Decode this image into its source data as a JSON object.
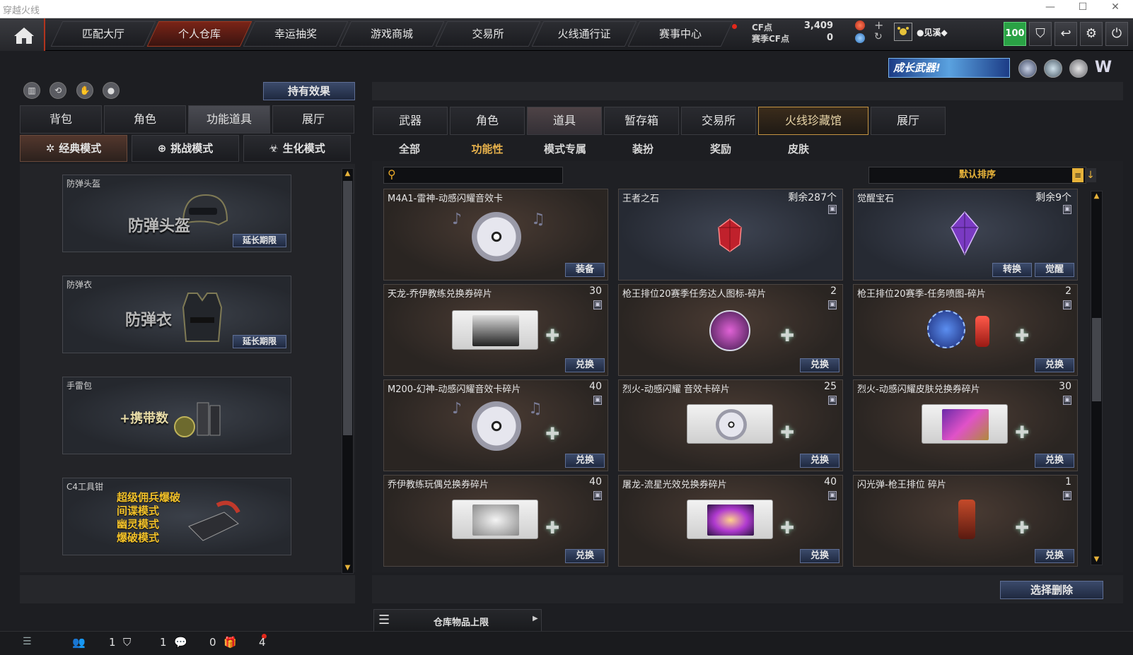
{
  "window": {
    "title": "穿越火线"
  },
  "nav": {
    "tabs": [
      "匹配大厅",
      "个人仓库",
      "幸运抽奖",
      "游戏商城",
      "交易所",
      "火线通行证",
      "赛事中心"
    ],
    "active_index": 1
  },
  "currency": {
    "cf_label": "CF点",
    "cf_value": "3,409",
    "season_label": "赛季CF点",
    "season_value": "0",
    "user": "●见溪◆",
    "level": "100"
  },
  "banner": {
    "text": "成长武器!"
  },
  "left": {
    "hold_effect": "持有效果",
    "tabs": [
      "背包",
      "角色",
      "功能道具",
      "展厅"
    ],
    "active_tab": 2,
    "modes": [
      "经典模式",
      "挑战模式",
      "生化模式"
    ],
    "active_mode": 0,
    "cards": [
      {
        "caption": "防弹头盔",
        "big": "防弹头盔",
        "button": "延长期限"
      },
      {
        "caption": "防弹衣",
        "big": "防弹衣",
        "button": "延长期限"
      },
      {
        "caption": "手雷包",
        "big": "+携带数",
        "button": ""
      },
      {
        "caption": "C4工具钳",
        "lines": [
          "超级佣兵爆破",
          "间谍模式",
          "幽灵模式",
          "爆破模式"
        ]
      }
    ]
  },
  "right": {
    "tabs": [
      "武器",
      "角色",
      "道具",
      "暂存箱",
      "交易所",
      "火线珍藏馆",
      "展厅"
    ],
    "active_tab": 2,
    "highlight_tab": 5,
    "subtabs": [
      "全部",
      "功能性",
      "模式专属",
      "装扮",
      "奖励",
      "皮肤"
    ],
    "active_subtab": 1,
    "search_placeholder": "",
    "sort_label": "默认排序",
    "items": [
      {
        "name": "M4A1-雷神-动感闪耀音效卡",
        "count": "",
        "buttons": [
          "装备"
        ]
      },
      {
        "name": "王者之石",
        "count": "剩余287个",
        "buttons": []
      },
      {
        "name": "觉醒宝石",
        "count": "剩余9个",
        "buttons": [
          "转换",
          "觉醒"
        ]
      },
      {
        "name": "天龙-乔伊教练兑换券碎片",
        "count": "30",
        "buttons": [
          "兑换"
        ]
      },
      {
        "name": "枪王排位20赛季任务达人图标-碎片",
        "count": "2",
        "buttons": [
          "兑换"
        ]
      },
      {
        "name": "枪王排位20赛季-任务喷图-碎片",
        "count": "2",
        "buttons": [
          "兑换"
        ]
      },
      {
        "name": "M200-幻神-动感闪耀音效卡碎片",
        "count": "40",
        "buttons": [
          "兑换"
        ]
      },
      {
        "name": "烈火-动感闪耀 音效卡碎片",
        "count": "25",
        "buttons": [
          "兑换"
        ]
      },
      {
        "name": "烈火-动感闪耀皮肤兑换券碎片",
        "count": "30",
        "buttons": [
          "兑换"
        ]
      },
      {
        "name": "乔伊教练玩偶兑换券碎片",
        "count": "40",
        "buttons": [
          "兑换"
        ]
      },
      {
        "name": "屠龙-流星光效兑换券碎片",
        "count": "40",
        "buttons": [
          "兑换"
        ]
      },
      {
        "name": "闪光弹-枪王排位 碎片",
        "count": "1",
        "buttons": [
          "兑换"
        ]
      }
    ],
    "select_delete": "选择删除",
    "capacity_label": "仓库物品上限"
  },
  "bottom": {
    "counts": [
      "1",
      "1",
      "0",
      "4"
    ]
  },
  "colors": {
    "accent_red": "#b2341e",
    "gold": "#e8b24c",
    "button_blue": "#2d3a58"
  }
}
